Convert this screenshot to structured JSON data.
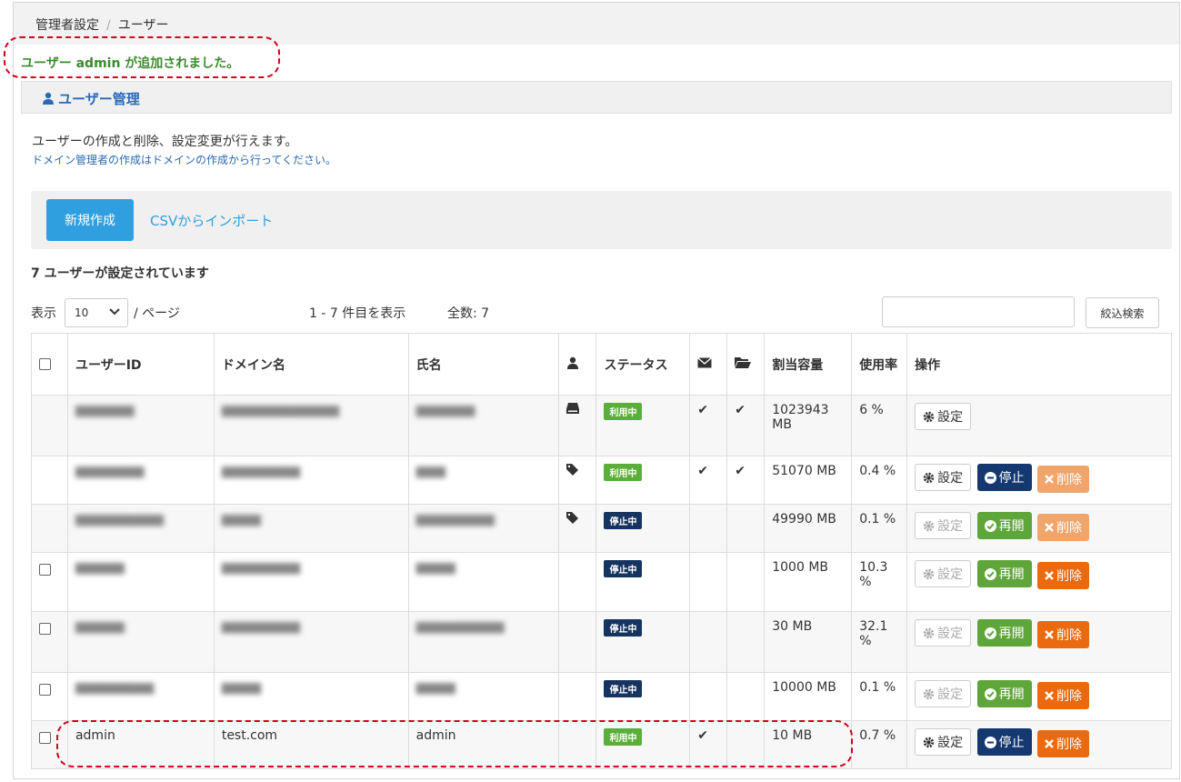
{
  "breadcrumb": {
    "parent": "管理者設定",
    "separator": "/",
    "current": "ユーザー"
  },
  "flash": "ユーザー admin が追加されました。",
  "panel": {
    "title": "ユーザー管理",
    "desc": "ユーザーの作成と削除、設定変更が行えます。",
    "note": "ドメイン管理者の作成はドメインの作成から行ってください。"
  },
  "actions": {
    "new": "新規作成",
    "csv": "CSVからインポート"
  },
  "count_title": "7 ユーザーが設定されています",
  "pager": {
    "show_label": "表示",
    "per_page": "10",
    "per_page_suffix": "/ ページ",
    "range": "1 - 7 件目を表示",
    "total": "全数: 7"
  },
  "search": {
    "button": "絞込検索",
    "placeholder": ""
  },
  "columns": {
    "user_id": "ユーザーID",
    "domain": "ドメイン名",
    "name": "氏名",
    "status": "ステータス",
    "quota": "割当容量",
    "usage": "使用率",
    "ops": "操作"
  },
  "labels": {
    "settings": "設定",
    "stop": "停止",
    "resume": "再開",
    "delete": "削除",
    "active": "利用中",
    "stopped": "停止中",
    "check": "✔"
  },
  "rows": [
    {
      "user_id": "",
      "domain": "",
      "name": "",
      "quota": "1023943 MB",
      "usage": "6 %"
    },
    {
      "user_id": "",
      "domain": "",
      "name": "",
      "quota": "51070 MB",
      "usage": "0.4 %"
    },
    {
      "user_id": "",
      "domain": "",
      "name": "",
      "quota": "49990 MB",
      "usage": "0.1 %"
    },
    {
      "user_id": "",
      "domain": "",
      "name": "",
      "quota": "1000 MB",
      "usage": "10.3 %"
    },
    {
      "user_id": "",
      "domain": "",
      "name": "",
      "quota": "30 MB",
      "usage": "32.1 %"
    },
    {
      "user_id": "",
      "domain": "",
      "name": "",
      "quota": "10000 MB",
      "usage": "0.1 %"
    },
    {
      "user_id": "admin",
      "domain": "test.com",
      "name": "admin",
      "quota": "10 MB",
      "usage": "0.7 %"
    }
  ],
  "colors": {
    "accent": "#2f9fe0",
    "active_badge": "#5cae3b",
    "stopped_badge": "#16345f",
    "delete": "#e96a10",
    "resume": "#5ea63a",
    "highlight": "#d0021b"
  }
}
